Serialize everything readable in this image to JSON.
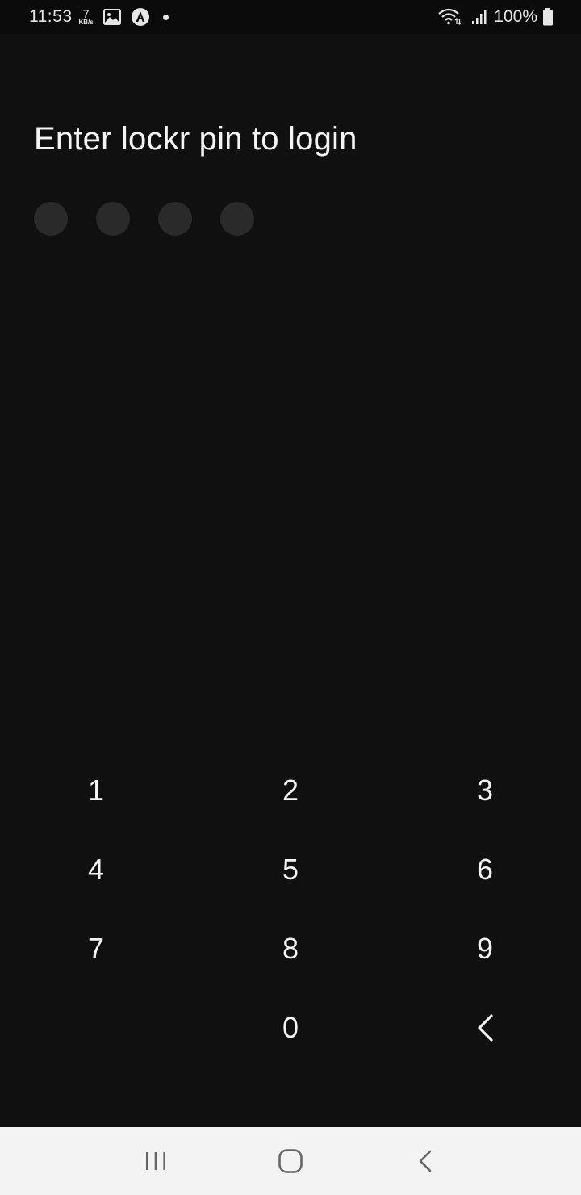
{
  "status_bar": {
    "time": "11:53",
    "speed_value": "7",
    "speed_unit": "KB/s",
    "battery_text": "100%"
  },
  "title": "Enter lockr pin to login",
  "pin": {
    "length": 4,
    "filled": 0
  },
  "keypad": {
    "keys": [
      "1",
      "2",
      "3",
      "4",
      "5",
      "6",
      "7",
      "8",
      "9",
      "",
      "0"
    ],
    "backspace_icon": "chevron-left-icon"
  },
  "nav_bar": {
    "icons": [
      "recent-apps-icon",
      "home-icon",
      "back-icon"
    ]
  },
  "colors": {
    "background": "#101011",
    "pin_dot": "#2a2a2b",
    "text": "#f4f4f4",
    "nav_bar": "#f3f3f3"
  }
}
